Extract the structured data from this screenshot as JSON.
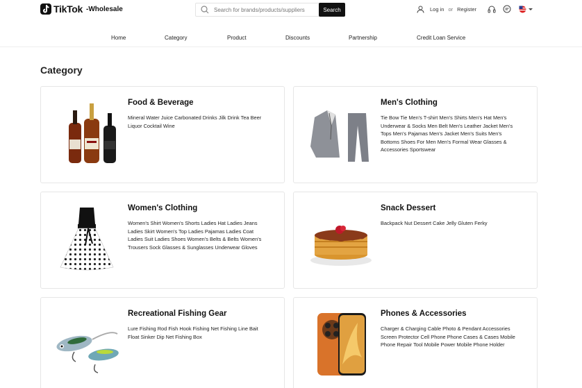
{
  "header": {
    "logo_text": "TikTok",
    "logo_sub": "-Wholesale",
    "search_placeholder": "Search for brands/products/suppliers",
    "search_button": "Search",
    "login": "Log in",
    "or": "or",
    "register": "Register"
  },
  "nav": [
    "Home",
    "Category",
    "Product",
    "Discounts",
    "Partnership",
    "Credit Loan Service"
  ],
  "page_title": "Category",
  "categories": [
    {
      "title": "Food & Beverage",
      "desc": "Mineral Water Juice Carbonated Drinks Jilk Drink Tea Beer Liquor Cocktail Wine",
      "icon": "liquor-bottles-image"
    },
    {
      "title": "Men's Clothing",
      "desc": "Tie Bow Tie Men's T-shirt Men's Shirts Men's Hat Men's Underwear & Socks Men Belt Men's Leather Jacket Men's Tops Men's Pajamas Men's Jacket Men's Suits Men's Bottoms Shoes For Men Men's Formal Wear Glasses & Accessories Sportswear",
      "icon": "suit-image"
    },
    {
      "title": "Women's Clothing",
      "desc": "Women's Shirt Women's Shorts Ladies Hat Ladies Jeans Ladies Skirt Women's Top Ladies Pajamas Ladies Coat Ladies Suit Ladies Shoes Women's Belts & Belts Women's Trousers Sock Glasses & Sunglasses Underwear Gloves",
      "icon": "polka-dot-dress-image"
    },
    {
      "title": "Snack Dessert",
      "desc": "Backpack Nut Dessert Cake Jelly Gluten Ferky",
      "icon": "pancakes-image"
    },
    {
      "title": "Recreational Fishing Gear",
      "desc": "Lure Fishing Rod Fish Hook Fishing Net Fishing Line Bait Float Sinker Dip Net Fishing Box",
      "icon": "fishing-lures-image"
    },
    {
      "title": "Phones & Accessories",
      "desc": "Charger & Charging Cable Photo & Pendant Accessories Screen Protector Cell Phone Phone Cases & Cases Mobile Phone Repair Tool Mobile Power Mobile Phone Holder",
      "icon": "smartphone-image"
    }
  ]
}
